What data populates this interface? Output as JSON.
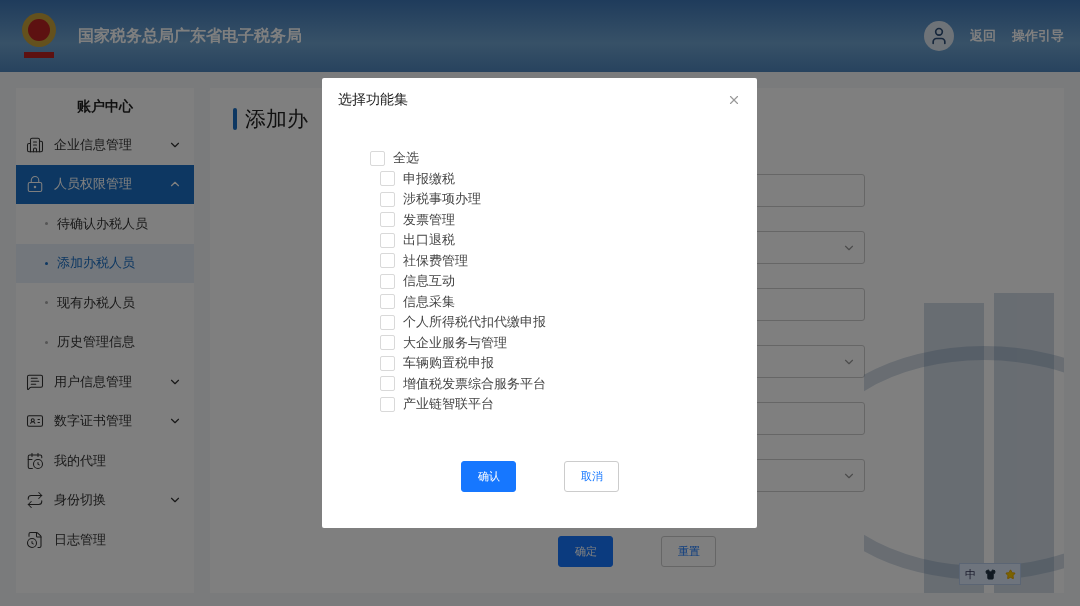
{
  "header": {
    "title": "国家税务总局广东省电子税务局",
    "links": [
      "返回",
      "操作引导"
    ]
  },
  "sidebar": {
    "title": "账户中心",
    "items": [
      {
        "label": "企业信息管理",
        "kind": "group",
        "expanded": false,
        "selected": false
      },
      {
        "label": "人员权限管理",
        "kind": "group",
        "expanded": true,
        "selected": true,
        "children": [
          {
            "label": "待确认办税人员",
            "selected": false
          },
          {
            "label": "添加办税人员",
            "selected": true
          },
          {
            "label": "现有办税人员",
            "selected": false
          },
          {
            "label": "历史管理信息",
            "selected": false
          }
        ]
      },
      {
        "label": "用户信息管理",
        "kind": "group",
        "expanded": false,
        "selected": false
      },
      {
        "label": "数字证书管理",
        "kind": "group",
        "expanded": false,
        "selected": false
      },
      {
        "label": "我的代理",
        "kind": "link",
        "selected": false
      },
      {
        "label": "身份切换",
        "kind": "group",
        "expanded": false,
        "selected": false
      },
      {
        "label": "日志管理",
        "kind": "link",
        "selected": false
      }
    ]
  },
  "main": {
    "title": "添加办",
    "fields": [
      {
        "kind": "input"
      },
      {
        "kind": "select"
      },
      {
        "kind": "input"
      },
      {
        "kind": "select"
      },
      {
        "kind": "input"
      },
      {
        "kind": "select"
      }
    ],
    "buttons": [
      {
        "label": "确定",
        "kind": "primary"
      },
      {
        "label": "重置",
        "kind": "default"
      }
    ]
  },
  "dialog": {
    "title": "选择功能集",
    "select_all": {
      "label": "全选",
      "checked": false
    },
    "options": [
      {
        "label": "申报缴税",
        "checked": false
      },
      {
        "label": "涉税事项办理",
        "checked": false
      },
      {
        "label": "发票管理",
        "checked": false
      },
      {
        "label": "出口退税",
        "checked": false
      },
      {
        "label": "社保费管理",
        "checked": false
      },
      {
        "label": "信息互动",
        "checked": false
      },
      {
        "label": "信息采集",
        "checked": false
      },
      {
        "label": "个人所得税代扣代缴申报",
        "checked": false
      },
      {
        "label": "大企业服务与管理",
        "checked": false
      },
      {
        "label": "车辆购置税申报",
        "checked": false
      },
      {
        "label": "增值税发票综合服务平台",
        "checked": false
      },
      {
        "label": "产业链智联平台",
        "checked": false
      }
    ],
    "buttons": [
      {
        "label": "确认",
        "kind": "primary"
      },
      {
        "label": "取消",
        "kind": "default"
      }
    ]
  },
  "ime": {
    "mode": "中"
  }
}
